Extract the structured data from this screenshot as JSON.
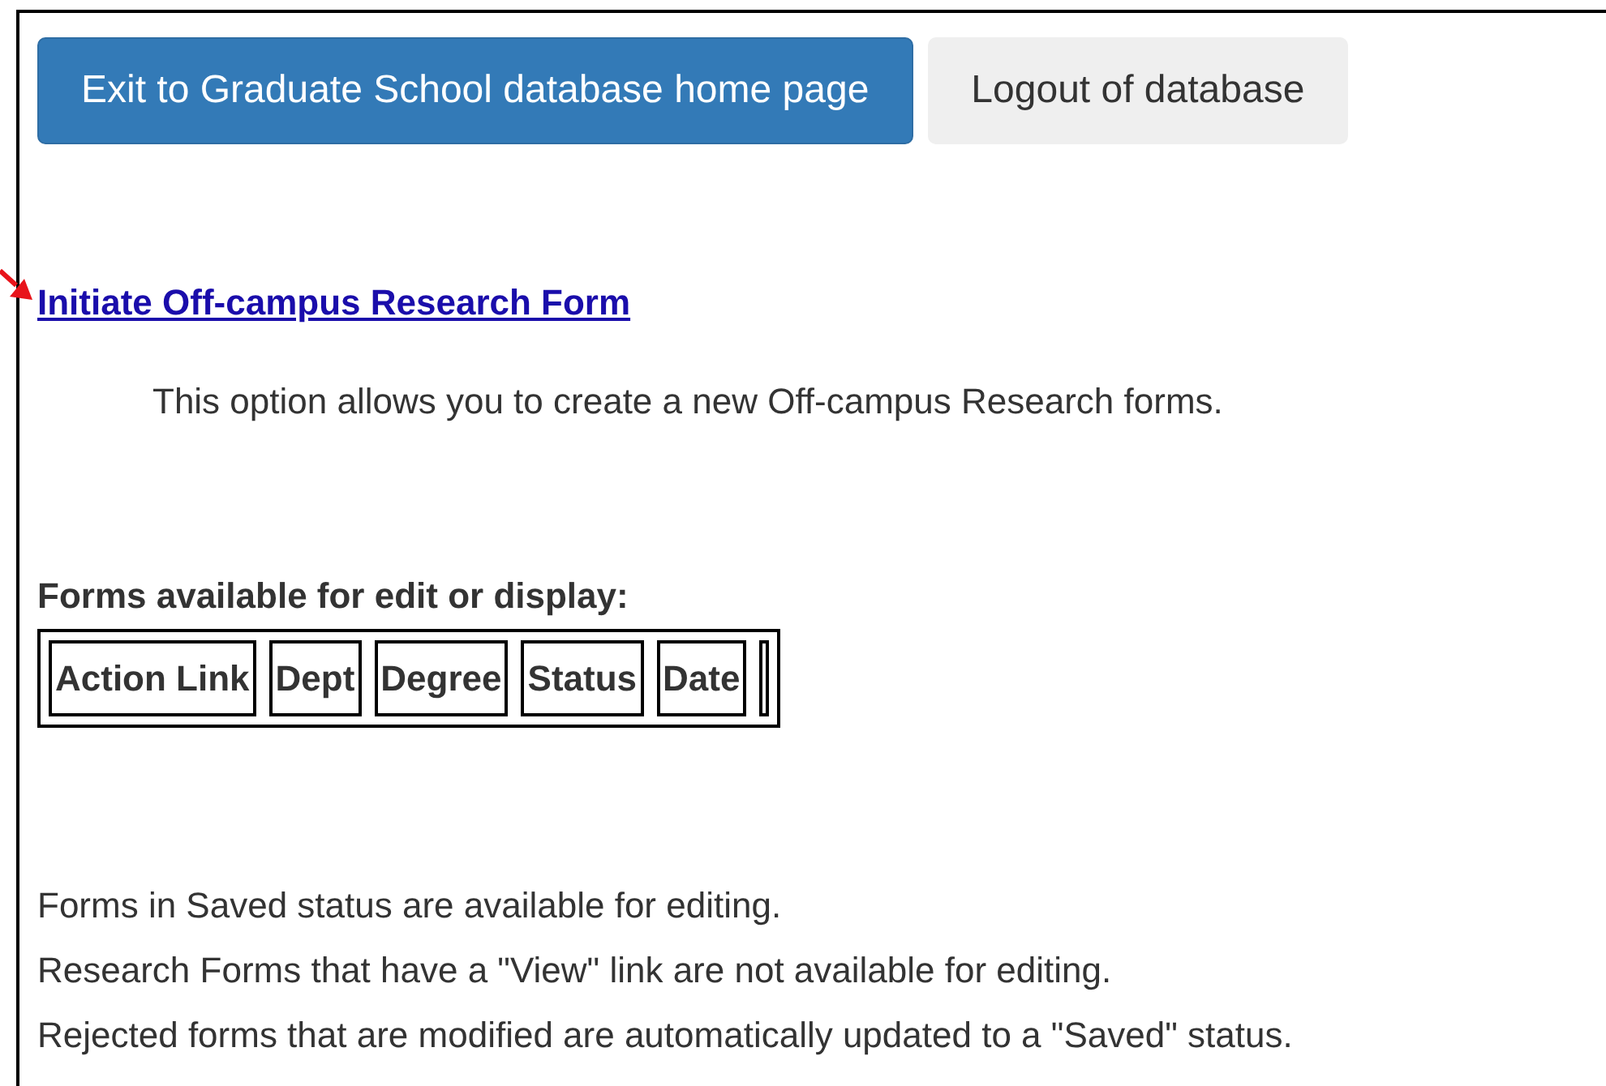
{
  "buttons": [
    {
      "label": "Exit to Graduate School database home page",
      "kind": "primary"
    },
    {
      "label": "Logout of database",
      "kind": "secondary"
    }
  ],
  "initiate_link": "Initiate Off-campus Research Form",
  "description": "This option allows you to create a new Off-campus Research forms.",
  "forms_heading": "Forms available for edit or display:",
  "table": {
    "columns": [
      "Action Link",
      "Dept",
      "Degree",
      "Status",
      "Date"
    ]
  },
  "notes": [
    "Forms in Saved status are available for editing.",
    "Research Forms that have a \"View\" link are not available for editing.",
    "Rejected forms that are modified are automatically updated to a \"Saved\" status."
  ]
}
